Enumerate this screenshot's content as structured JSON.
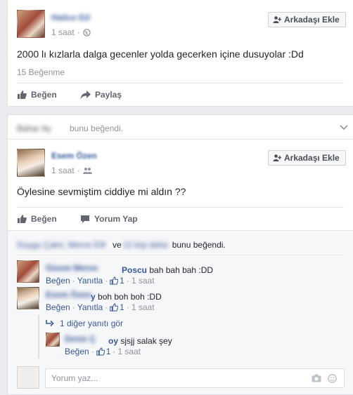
{
  "post1": {
    "author_name": "Hatice Ed",
    "time": "1 saat",
    "add_friend_label": "Arkadaşı Ekle",
    "text": "2000 lı kızlarla dalga gecenler yolda gecerken içine dusuyolar :Dd",
    "likes_count": "15 Beğenme",
    "like_label": "Beğen",
    "share_label": "Paylaş"
  },
  "story": {
    "liker_name": "Bahar Ay",
    "text": "bunu beğendi."
  },
  "post2": {
    "author_name": "Esem Özen",
    "time": "1 saat",
    "add_friend_label": "Arkadaşı Ekle",
    "text": "Öylesine sevmiştim ciddiye mi aldın ??",
    "like_label": "Beğen",
    "comment_label": "Yorum Yap",
    "likers_prefix": "Duygu Çakır, Merve Elif",
    "likers_mid": "ve",
    "likers_others": "12 kişi daha",
    "likers_suffix": "bunu beğendi."
  },
  "comments": [
    {
      "author_hidden": "Gizem Merve",
      "author_visible": "Poscu",
      "text": "bah bah bah :DD",
      "like_label": "Beğen",
      "reply_label": "Yanıtla",
      "likes": "1",
      "time": "1 saat"
    },
    {
      "author_hidden": "Esem Özen",
      "author_visible": "y",
      "text": "boh boh boh :DD",
      "like_label": "Beğen",
      "reply_label": "Yanıtla",
      "likes": "1",
      "time": "1 saat"
    }
  ],
  "replies": {
    "more_replies": "1 diğer yanıtı gör",
    "reply_author_hidden": "Deniz Ç",
    "reply_author_visible": "oy",
    "reply_text": "sjsjj salak şey",
    "like_label": "Beğen",
    "likes": "1",
    "time": "1 saat"
  },
  "composer": {
    "placeholder": "Yorum yaz..."
  },
  "colors": {
    "link": "#365899",
    "meta": "#90949c",
    "background": "#e9ebee"
  }
}
